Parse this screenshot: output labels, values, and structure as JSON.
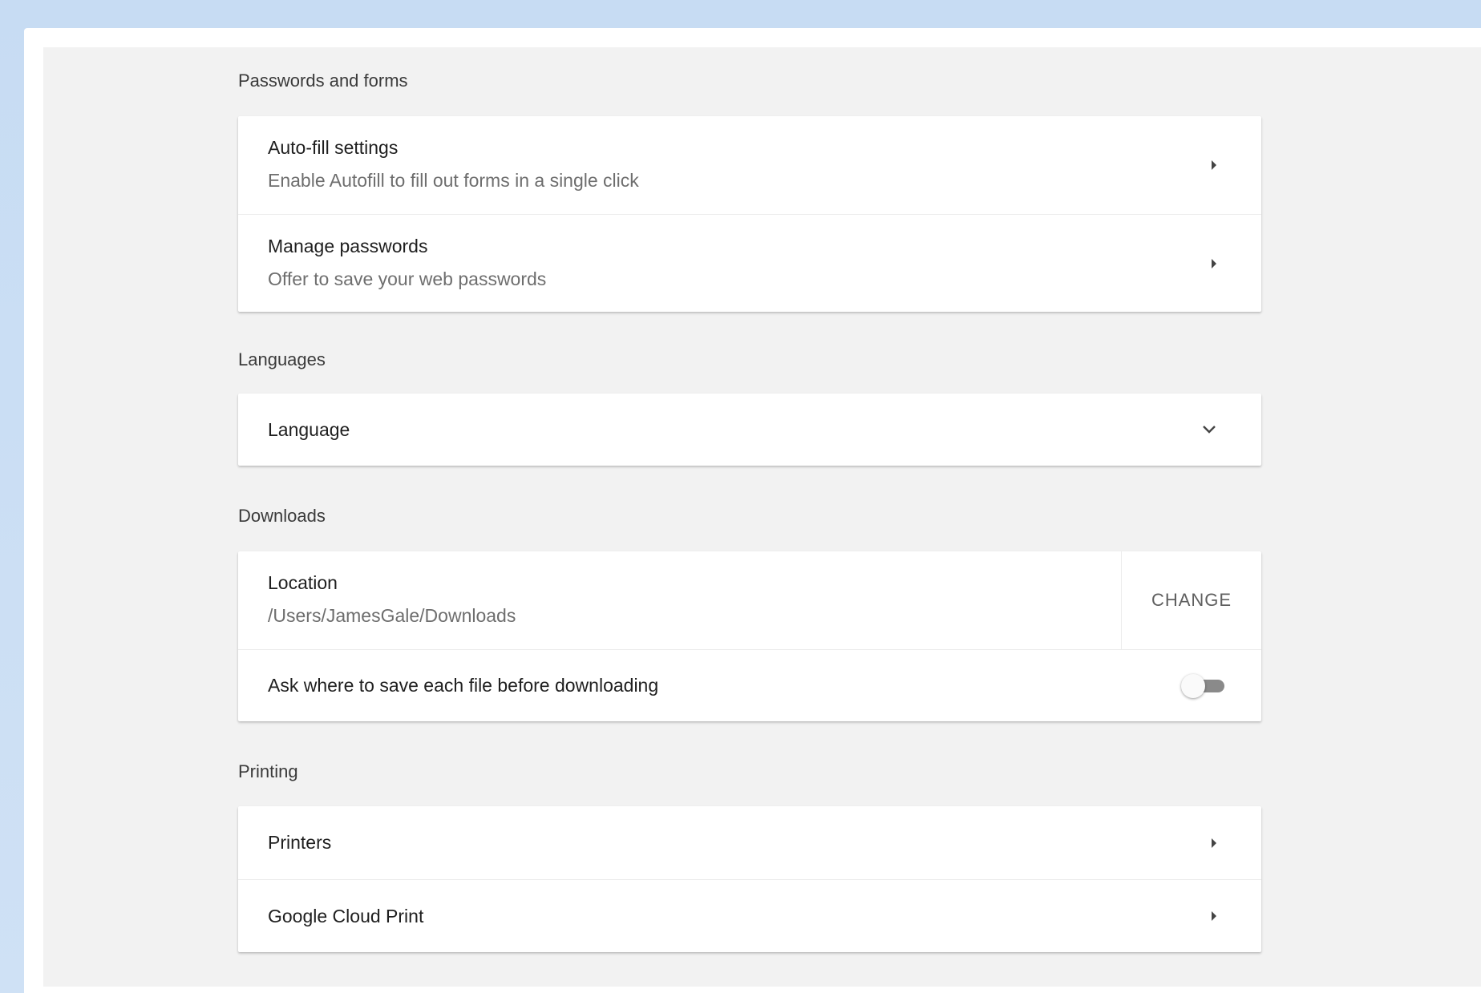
{
  "sections": {
    "passwords": {
      "title": "Passwords and forms",
      "autofill": {
        "title": "Auto-fill settings",
        "subtitle": "Enable Autofill to fill out forms in a single click"
      },
      "manage_passwords": {
        "title": "Manage passwords",
        "subtitle": "Offer to save your web passwords"
      }
    },
    "languages": {
      "title": "Languages",
      "language": {
        "title": "Language"
      }
    },
    "downloads": {
      "title": "Downloads",
      "location": {
        "title": "Location",
        "value": "/Users/JamesGale/Downloads",
        "change_label": "CHANGE"
      },
      "ask_before": {
        "title": "Ask where to save each file before downloading",
        "enabled": false
      }
    },
    "printing": {
      "title": "Printing",
      "printers": {
        "title": "Printers"
      },
      "cloud_print": {
        "title": "Google Cloud Print"
      }
    }
  },
  "icons": {
    "row_arrow": "arrow-right-icon",
    "expand": "chevron-down-icon"
  },
  "colors": {
    "page_background": "#f2f2f2",
    "card_background": "#ffffff",
    "frame_background": "#c7dcf3"
  }
}
